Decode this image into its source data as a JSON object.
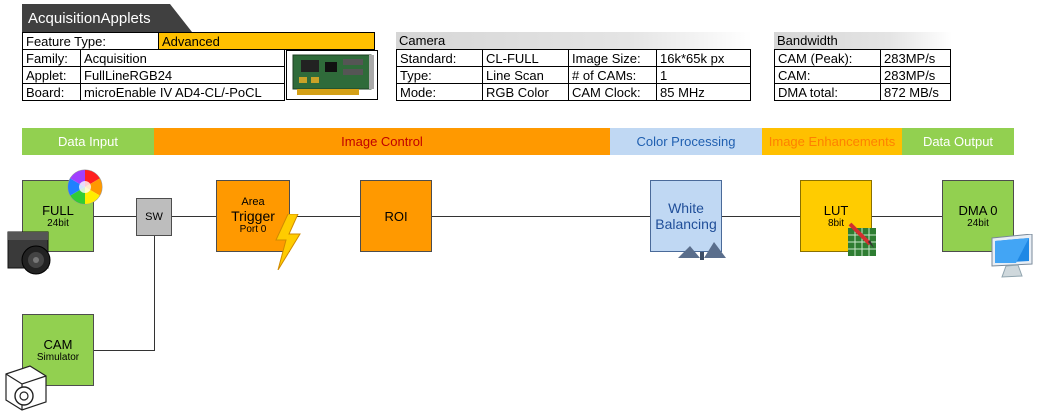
{
  "title": "AcquisitionApplets",
  "feature": {
    "label": "Feature Type:",
    "value": "Advanced"
  },
  "general": [
    {
      "label": "Family:",
      "value": "Acquisition"
    },
    {
      "label": "Applet:",
      "value": "FullLineRGB24"
    },
    {
      "label": "Board:",
      "value": "microEnable IV AD4-CL/-PoCL"
    }
  ],
  "camera": {
    "title": "Camera",
    "rows": [
      {
        "label": "Standard:",
        "value": "CL-FULL",
        "label2": "Image Size:",
        "value2": "16k*65k px"
      },
      {
        "label": "Type:",
        "value": "Line Scan",
        "label2": "# of CAMs:",
        "value2": "1"
      },
      {
        "label": "Mode:",
        "value": "RGB Color",
        "label2": "CAM Clock:",
        "value2": "85 MHz"
      }
    ]
  },
  "bandwidth": {
    "title": "Bandwidth",
    "rows": [
      {
        "label": "CAM (Peak):",
        "value": "283MP/s"
      },
      {
        "label": "CAM:",
        "value": "283MP/s"
      },
      {
        "label": "DMA total:",
        "value": "872 MB/s"
      }
    ]
  },
  "stages": [
    {
      "label": "Data Input",
      "bg": "#92d050",
      "color": "#ffffff"
    },
    {
      "label": "Image Control",
      "bg": "#ff9900",
      "color": "#c00000"
    },
    {
      "label": "Color Processing",
      "bg": "#c0d8f3",
      "color": "#1f5fb0"
    },
    {
      "label": "Image Enhancements",
      "bg": "#ffc000",
      "color": "#ff8000"
    },
    {
      "label": "Data Output",
      "bg": "#92d050",
      "color": "#ffffff"
    }
  ],
  "blocks": {
    "full": {
      "main": "FULL",
      "sub": "24bit"
    },
    "sw": {
      "main": "SW"
    },
    "trigger": {
      "top": "Area",
      "main": "Trigger",
      "sub": "Port 0"
    },
    "roi": {
      "main": "ROI"
    },
    "white_balancing": {
      "line1": "White",
      "line2": "Balancing"
    },
    "lut": {
      "main": "LUT",
      "sub": "8bit"
    },
    "dma": {
      "main": "DMA 0",
      "sub": "24bit"
    },
    "cam_sim": {
      "main": "CAM",
      "sub": "Simulator"
    }
  },
  "icons": [
    "color-wheel-icon",
    "camera-icon",
    "lightning-icon",
    "balance-scale-icon",
    "lut-grid-icon",
    "monitor-icon",
    "simulator-camera-icon",
    "pcb-board-image"
  ]
}
